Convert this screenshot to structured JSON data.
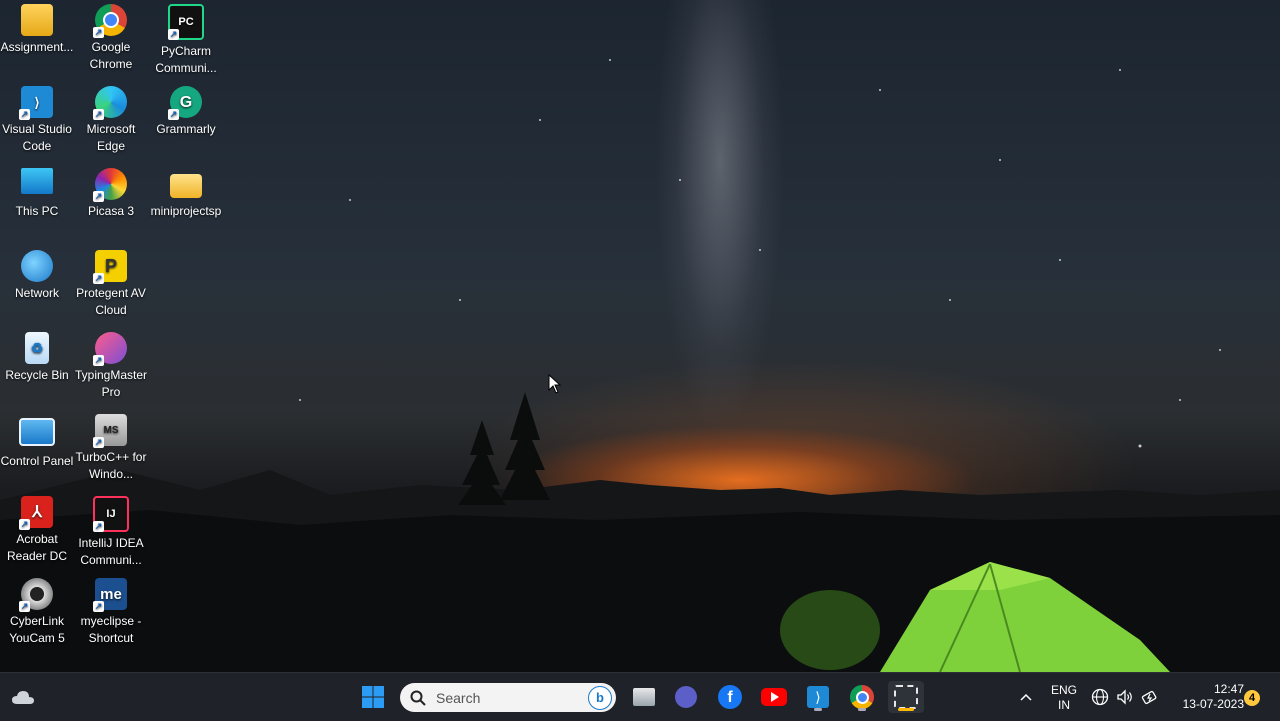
{
  "desktop": {
    "icons": [
      {
        "label": "Assignment...",
        "icon": "folder-icon"
      },
      {
        "label": "Google Chrome",
        "icon": "chrome-icon"
      },
      {
        "label": "PyCharm Communi...",
        "icon": "pycharm-icon"
      },
      {
        "label": "Visual Studio Code",
        "icon": "vscode-icon"
      },
      {
        "label": "Microsoft Edge",
        "icon": "edge-icon"
      },
      {
        "label": "Grammarly",
        "icon": "grammarly-icon"
      },
      {
        "label": "This PC",
        "icon": "monitor-icon"
      },
      {
        "label": "Picasa 3",
        "icon": "picasa-icon"
      },
      {
        "label": "miniprojectsp",
        "icon": "folder-icon"
      },
      {
        "label": "Network",
        "icon": "network-icon"
      },
      {
        "label": "Protegent AV Cloud",
        "icon": "protegent-icon"
      },
      {
        "label": "Recycle Bin",
        "icon": "recycle-bin-icon"
      },
      {
        "label": "TypingMaster Pro",
        "icon": "typingmaster-icon"
      },
      {
        "label": "Control Panel",
        "icon": "control-panel-icon"
      },
      {
        "label": "TurboC++ for Windo...",
        "icon": "turboc-icon"
      },
      {
        "label": "Acrobat Reader DC",
        "icon": "acrobat-icon"
      },
      {
        "label": "IntelliJ IDEA Communi...",
        "icon": "intellij-icon"
      },
      {
        "label": "CyberLink YouCam 5",
        "icon": "youcam-icon"
      },
      {
        "label": "myeclipse - Shortcut",
        "icon": "myeclipse-icon"
      }
    ]
  },
  "taskbar": {
    "search_placeholder": "Search",
    "apps": [
      "start-icon",
      "file-explorer-icon",
      "teams-icon",
      "facebook-icon",
      "youtube-icon",
      "vscode-icon",
      "chrome-icon",
      "snipping-tool-icon"
    ],
    "language_line1": "ENG",
    "language_line2": "IN",
    "time": "12:47",
    "date": "13-07-2023",
    "notification_count": "4"
  },
  "colors": {
    "taskbar_bg": "#1f2329",
    "accent": "#0078d4"
  }
}
